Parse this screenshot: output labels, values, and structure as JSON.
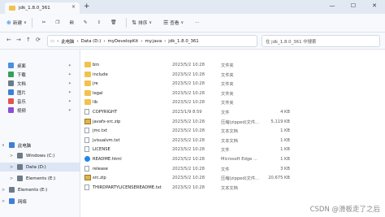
{
  "window": {
    "tab_title": "jdk_1.8.0_361",
    "tab_close": "×",
    "new_tab": "+",
    "controls": [
      "—",
      "☐",
      "✕"
    ]
  },
  "toolbar": {
    "new_label": "新建",
    "sort_label": "排序",
    "view_label": "查看",
    "more_label": "···"
  },
  "nav": {
    "back": "←",
    "forward": "→",
    "up": "↑",
    "refresh": "⟳"
  },
  "address": {
    "path": [
      "此电脑",
      "Data (D:)",
      "myDevelopKit",
      "my.java",
      "jdk_1.8.0_361"
    ],
    "search_placeholder": "在 jdk_1.8.0_361 中搜索"
  },
  "sidebar": [
    {
      "label": "桌面",
      "color": "#4a8fe0",
      "pinned": true
    },
    {
      "label": "下载",
      "color": "#35a05a",
      "pinned": true
    },
    {
      "label": "文档",
      "color": "#6c7a89",
      "pinned": true
    },
    {
      "label": "图片",
      "color": "#3f7fd6",
      "pinned": true
    },
    {
      "label": "音乐",
      "color": "#e0574a",
      "pinned": true
    },
    {
      "label": "视频",
      "color": "#8a4fd6",
      "pinned": true
    },
    {
      "label": "此电脑",
      "color": "#3f7fd6",
      "expand": "∨",
      "indent": 2
    },
    {
      "label": "Windows (C:)",
      "color": "#6c7a89",
      "expand": ">",
      "indent": 12
    },
    {
      "label": "Data (D:)",
      "color": "#6c7a89",
      "expand": ">",
      "indent": 12,
      "selected": true
    },
    {
      "label": "Elements (E:)",
      "color": "#6c7a89",
      "expand": ">",
      "indent": 12
    },
    {
      "label": "Elements (E:)",
      "color": "#6c7a89",
      "expand": ">",
      "indent": 2
    },
    {
      "label": "网络",
      "color": "#3f7fd6",
      "expand": ">",
      "indent": 2
    }
  ],
  "files": [
    {
      "name": "bin",
      "date": "2023/5/2 10:28",
      "type": "文件夹",
      "size": "",
      "icon": "folder"
    },
    {
      "name": "include",
      "date": "2023/5/2 10:28",
      "type": "文件夹",
      "size": "",
      "icon": "folder"
    },
    {
      "name": "jre",
      "date": "2023/5/2 10:28",
      "type": "文件夹",
      "size": "",
      "icon": "folder"
    },
    {
      "name": "legal",
      "date": "2023/5/2 10:28",
      "type": "文件夹",
      "size": "",
      "icon": "folder"
    },
    {
      "name": "lib",
      "date": "2023/5/2 10:28",
      "type": "文件夹",
      "size": "",
      "icon": "folder"
    },
    {
      "name": "COPYRIGHT",
      "date": "2023/1/9 8:59",
      "type": "文件",
      "size": "4 KB",
      "icon": "file"
    },
    {
      "name": "javafx-src.zip",
      "date": "2023/5/2 10:28",
      "type": "压缩(zipped)文件...",
      "size": "5,119 KB",
      "icon": "zip"
    },
    {
      "name": "jmc.txt",
      "date": "2023/5/2 10:28",
      "type": "文本文档",
      "size": "1 KB",
      "icon": "file"
    },
    {
      "name": "jvisualvm.txt",
      "date": "2023/5/2 10:28",
      "type": "文本文档",
      "size": "1 KB",
      "icon": "file"
    },
    {
      "name": "LICENSE",
      "date": "2023/5/2 10:28",
      "type": "文件",
      "size": "1 KB",
      "icon": "file"
    },
    {
      "name": "README.html",
      "date": "2023/5/2 10:28",
      "type": "Microsoft Edge ...",
      "size": "1 KB",
      "icon": "html"
    },
    {
      "name": "release",
      "date": "2023/5/2 10:28",
      "type": "文件",
      "size": "3 KB",
      "icon": "file"
    },
    {
      "name": "src.zip",
      "date": "2023/5/2 10:28",
      "type": "压缩(zipped)文件...",
      "size": "20,675 KB",
      "icon": "zip"
    },
    {
      "name": "THIRDPARTYLICENSEREADME.txt",
      "date": "2023/5/2 10:28",
      "type": "文本文档",
      "size": "",
      "icon": "file"
    }
  ],
  "watermark": "CSDN @滑板走了之后"
}
